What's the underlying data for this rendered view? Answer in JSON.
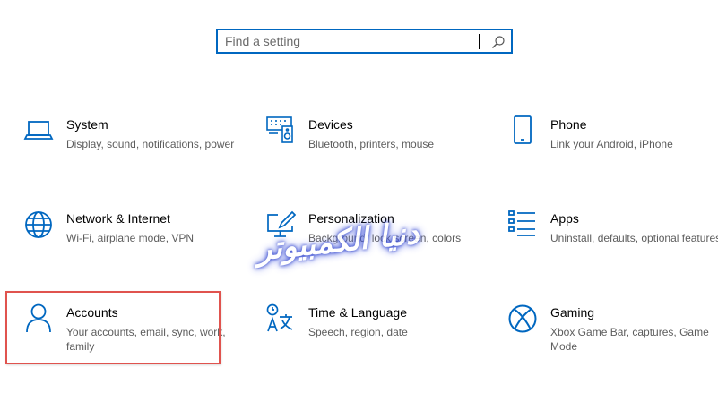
{
  "search": {
    "placeholder": "Find a setting",
    "value": ""
  },
  "tiles": [
    {
      "title": "System",
      "desc": "Display, sound, notifications, power",
      "icon": "laptop-icon"
    },
    {
      "title": "Devices",
      "desc": "Bluetooth, printers, mouse",
      "icon": "keyboard-speaker-icon"
    },
    {
      "title": "Phone",
      "desc": "Link your Android, iPhone",
      "icon": "phone-icon"
    },
    {
      "title": "Network & Internet",
      "desc": "Wi-Fi, airplane mode, VPN",
      "icon": "globe-icon"
    },
    {
      "title": "Personalization",
      "desc": "Background, lock screen, colors",
      "icon": "paintbrush-monitor-icon"
    },
    {
      "title": "Apps",
      "desc": "Uninstall, defaults, optional features",
      "icon": "apps-list-icon"
    },
    {
      "title": "Accounts",
      "desc": "Your accounts, email, sync, work, family",
      "icon": "person-icon"
    },
    {
      "title": "Time & Language",
      "desc": "Speech, region, date",
      "icon": "time-language-icon"
    },
    {
      "title": "Gaming",
      "desc": "Xbox Game Bar, captures, Game Mode",
      "icon": "xbox-icon"
    }
  ],
  "watermark": "دنيا الكمبيوتر",
  "colors": {
    "accent": "#0067c0",
    "highlight": "#e0534e",
    "description": "#5d5d5d"
  }
}
